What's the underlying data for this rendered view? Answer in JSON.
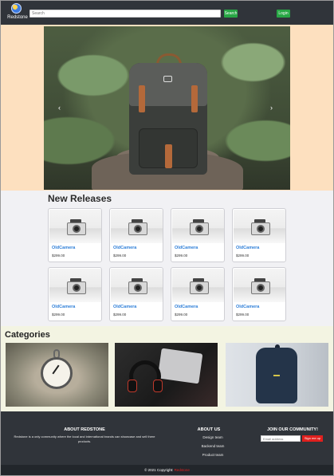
{
  "navbar": {
    "brand": "Redstone",
    "search_placeholder": "Search",
    "search_button": "Search",
    "login_button": "Login"
  },
  "hero": {
    "prev_arrow": "‹",
    "next_arrow": "›"
  },
  "releases": {
    "title": "New Releases",
    "products": [
      {
        "name": "OldCamera",
        "price": "$299.00"
      },
      {
        "name": "OldCamera",
        "price": "$299.00"
      },
      {
        "name": "OldCamera",
        "price": "$299.00"
      },
      {
        "name": "OldCamera",
        "price": "$299.00"
      },
      {
        "name": "OldCamera",
        "price": "$299.00"
      },
      {
        "name": "OldCamera",
        "price": "$299.00"
      },
      {
        "name": "OldCamera",
        "price": "$299.00"
      },
      {
        "name": "OldCamera",
        "price": "$299.00"
      }
    ]
  },
  "categories": {
    "title": "Categories",
    "icons": [
      "pocket-watch-icon",
      "headphones-laptop-icon",
      "backpack-icon"
    ]
  },
  "footer": {
    "about_title": "ABOUT REDSTONE",
    "about_text": "Redstone is a only community where the local and international brands can showcase and sell there products.",
    "aboutus_title": "ABOUT US",
    "aboutus_links": [
      "Design team",
      "Backend team",
      "Product team"
    ],
    "community_title": "JOIN OUR COMMUNITY!",
    "email_placeholder": "Email address",
    "signup_button": "Sign me up",
    "copyright_prefix": "© 2021 Copyright: ",
    "copyright_brand": "Redstone"
  }
}
